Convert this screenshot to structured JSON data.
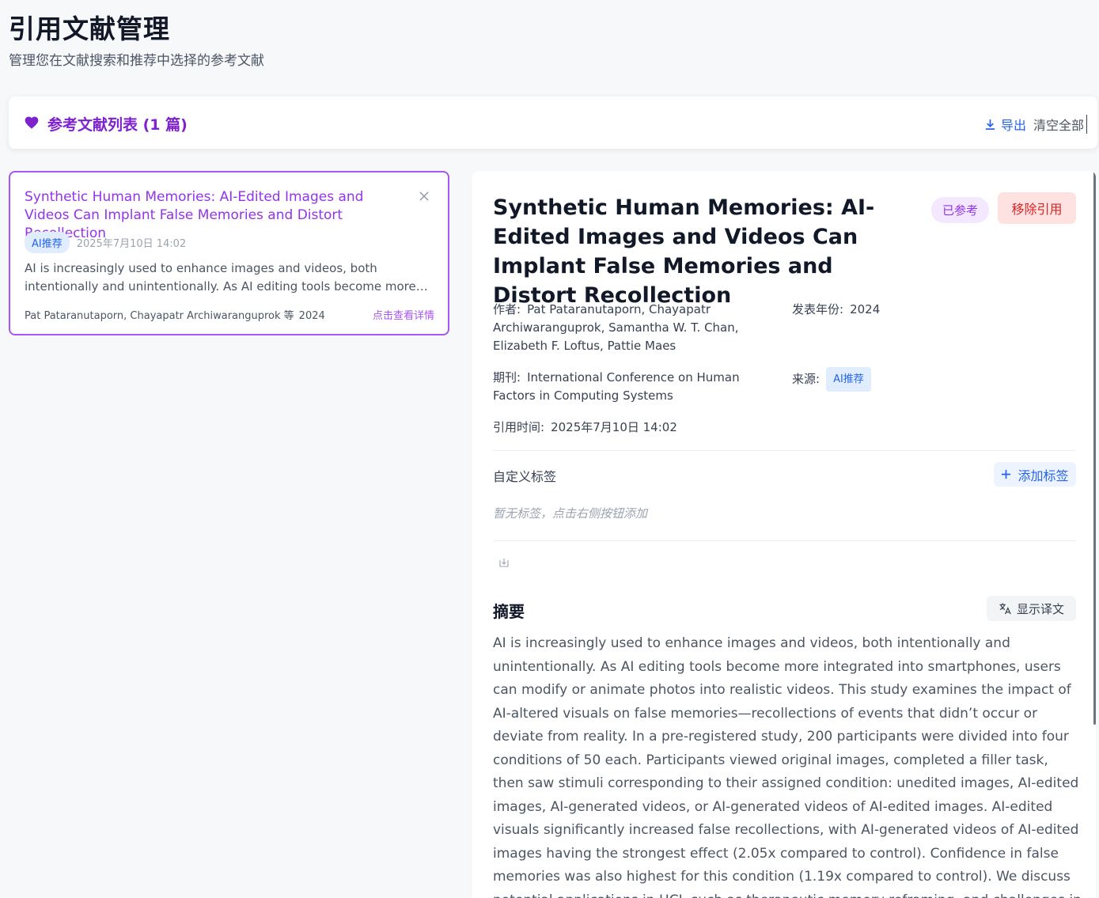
{
  "page": {
    "title": "引用文献管理",
    "subtitle": "管理您在文献搜索和推荐中选择的参考文献"
  },
  "list_header": {
    "title": "参考文献列表 (1 篇)",
    "icon": "heart-icon",
    "export_label": "导出",
    "clear_label": "清空全部"
  },
  "reference_card": {
    "title": "Synthetic Human Memories: AI-Edited Images and Videos Can Implant False Memories and Distort Recollection",
    "source_badge": "AI推荐",
    "date": "2025年7月10日 14:02",
    "abstract_preview": "AI is increasingly used to enhance images and videos, both intentionally and unintentionally. As AI editing tools become more integrated into smartphones, users can modify or animate photos into realistic videos.",
    "authors": "Pat Pataranutaporn, Chayapatr Archiwaranguprok 等",
    "year": "2024",
    "detail_link": "点击查看详情"
  },
  "detail": {
    "title": "Synthetic Human Memories: AI-Edited Images and Videos Can Implant False Memories and Distort Recollection",
    "status_badge": "已参考",
    "remove_label": "移除引用",
    "authors_label": "作者:",
    "authors": "Pat Pataranutaporn, Chayapatr Archiwaranguprok, Samantha W. T. Chan, Elizabeth F. Loftus, Pattie Maes",
    "year_label": "发表年份:",
    "year": "2024",
    "journal_label": "期刊:",
    "journal": "International Conference on Human Factors in Computing Systems",
    "source_label": "来源:",
    "source": "AI推荐",
    "cited_time_label": "引用时间:",
    "cited_time": "2025年7月10日 14:02",
    "tags_title": "自定义标签",
    "add_tag_label": "添加标签",
    "no_tags": "暂无标签，点击右侧按钮添加",
    "abstract_title": "摘要",
    "translate_label": "显示译文",
    "abstract": "AI is increasingly used to enhance images and videos, both intentionally and unintentionally. As AI editing tools become more integrated into smartphones, users can modify or animate photos into realistic videos. This study examines the impact of AI-altered visuals on false memories—recollections of events that didn’t occur or deviate from reality. In a pre-registered study, 200 participants were divided into four conditions of 50 each. Participants viewed original images, completed a filler task, then saw stimuli corresponding to their assigned condition: unedited images, AI-edited images, AI-generated videos, or AI-generated videos of AI-edited images. AI-edited visuals significantly increased false recollections, with AI-generated videos of AI-edited images having the strongest effect (2.05x compared to control). Confidence in false memories was also highest for this condition (1.19x compared to control). We discuss potential applications in HCI, such as therapeutic memory reframing, and challenges in ethical, legal, political, and societal domains."
  },
  "colors": {
    "accent_purple": "#9333ea",
    "link_blue": "#2563eb",
    "danger_red": "#dc2626"
  }
}
